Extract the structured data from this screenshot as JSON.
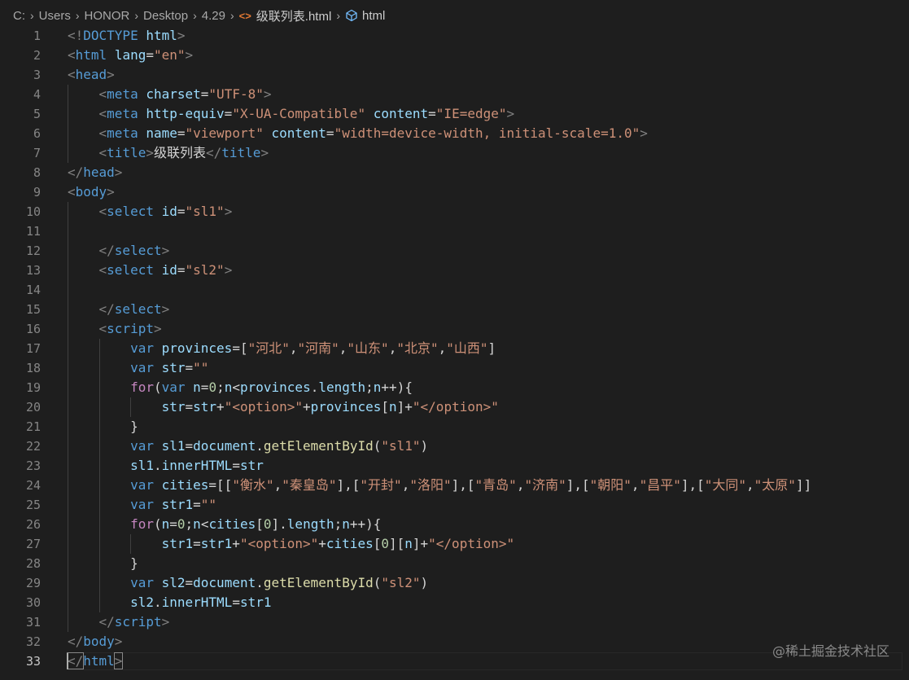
{
  "breadcrumb": [
    "C:",
    "Users",
    "HONOR",
    "Desktop",
    "4.29",
    "级联列表.html",
    "html"
  ],
  "code_lines": [
    [
      [
        "t-br",
        "<!"
      ],
      [
        "t-tag",
        "DOCTYPE"
      ],
      [
        "t-tx",
        " "
      ],
      [
        "t-at",
        "html"
      ],
      [
        "t-br",
        ">"
      ]
    ],
    [
      [
        "t-br",
        "<"
      ],
      [
        "t-tag",
        "html"
      ],
      [
        "t-tx",
        " "
      ],
      [
        "t-at",
        "lang"
      ],
      [
        "t-tx",
        "="
      ],
      [
        "t-str",
        "\"en\""
      ],
      [
        "t-br",
        ">"
      ]
    ],
    [
      [
        "t-br",
        "<"
      ],
      [
        "t-tag",
        "head"
      ],
      [
        "t-br",
        ">"
      ]
    ],
    [
      [
        "t-tx",
        "    "
      ],
      [
        "t-br",
        "<"
      ],
      [
        "t-tag",
        "meta"
      ],
      [
        "t-tx",
        " "
      ],
      [
        "t-at",
        "charset"
      ],
      [
        "t-tx",
        "="
      ],
      [
        "t-str",
        "\"UTF-8\""
      ],
      [
        "t-br",
        ">"
      ]
    ],
    [
      [
        "t-tx",
        "    "
      ],
      [
        "t-br",
        "<"
      ],
      [
        "t-tag",
        "meta"
      ],
      [
        "t-tx",
        " "
      ],
      [
        "t-at",
        "http-equiv"
      ],
      [
        "t-tx",
        "="
      ],
      [
        "t-str",
        "\"X-UA-Compatible\""
      ],
      [
        "t-tx",
        " "
      ],
      [
        "t-at",
        "content"
      ],
      [
        "t-tx",
        "="
      ],
      [
        "t-str",
        "\"IE=edge\""
      ],
      [
        "t-br",
        ">"
      ]
    ],
    [
      [
        "t-tx",
        "    "
      ],
      [
        "t-br",
        "<"
      ],
      [
        "t-tag",
        "meta"
      ],
      [
        "t-tx",
        " "
      ],
      [
        "t-at",
        "name"
      ],
      [
        "t-tx",
        "="
      ],
      [
        "t-str",
        "\"viewport\""
      ],
      [
        "t-tx",
        " "
      ],
      [
        "t-at",
        "content"
      ],
      [
        "t-tx",
        "="
      ],
      [
        "t-str",
        "\"width=device-width, initial-scale=1.0\""
      ],
      [
        "t-br",
        ">"
      ]
    ],
    [
      [
        "t-tx",
        "    "
      ],
      [
        "t-br",
        "<"
      ],
      [
        "t-tag",
        "title"
      ],
      [
        "t-br",
        ">"
      ],
      [
        "t-tx",
        "级联列表"
      ],
      [
        "t-br",
        "</"
      ],
      [
        "t-tag",
        "title"
      ],
      [
        "t-br",
        ">"
      ]
    ],
    [
      [
        "t-br",
        "</"
      ],
      [
        "t-tag",
        "head"
      ],
      [
        "t-br",
        ">"
      ]
    ],
    [
      [
        "t-br",
        "<"
      ],
      [
        "t-tag",
        "body"
      ],
      [
        "t-br",
        ">"
      ]
    ],
    [
      [
        "t-tx",
        "    "
      ],
      [
        "t-br",
        "<"
      ],
      [
        "t-tag",
        "select"
      ],
      [
        "t-tx",
        " "
      ],
      [
        "t-at",
        "id"
      ],
      [
        "t-tx",
        "="
      ],
      [
        "t-str",
        "\"sl1\""
      ],
      [
        "t-br",
        ">"
      ]
    ],
    [],
    [
      [
        "t-tx",
        "    "
      ],
      [
        "t-br",
        "</"
      ],
      [
        "t-tag",
        "select"
      ],
      [
        "t-br",
        ">"
      ]
    ],
    [
      [
        "t-tx",
        "    "
      ],
      [
        "t-br",
        "<"
      ],
      [
        "t-tag",
        "select"
      ],
      [
        "t-tx",
        " "
      ],
      [
        "t-at",
        "id"
      ],
      [
        "t-tx",
        "="
      ],
      [
        "t-str",
        "\"sl2\""
      ],
      [
        "t-br",
        ">"
      ]
    ],
    [],
    [
      [
        "t-tx",
        "    "
      ],
      [
        "t-br",
        "</"
      ],
      [
        "t-tag",
        "select"
      ],
      [
        "t-br",
        ">"
      ]
    ],
    [
      [
        "t-tx",
        "    "
      ],
      [
        "t-br",
        "<"
      ],
      [
        "t-tag",
        "script"
      ],
      [
        "t-br",
        ">"
      ]
    ],
    [
      [
        "t-tx",
        "        "
      ],
      [
        "t-kw",
        "var"
      ],
      [
        "t-tx",
        " "
      ],
      [
        "t-var",
        "provinces"
      ],
      [
        "t-tx",
        "=["
      ],
      [
        "t-str",
        "\"河北\""
      ],
      [
        "t-tx",
        ","
      ],
      [
        "t-str",
        "\"河南\""
      ],
      [
        "t-tx",
        ","
      ],
      [
        "t-str",
        "\"山东\""
      ],
      [
        "t-tx",
        ","
      ],
      [
        "t-str",
        "\"北京\""
      ],
      [
        "t-tx",
        ","
      ],
      [
        "t-str",
        "\"山西\""
      ],
      [
        "t-tx",
        "]"
      ]
    ],
    [
      [
        "t-tx",
        "        "
      ],
      [
        "t-kw",
        "var"
      ],
      [
        "t-tx",
        " "
      ],
      [
        "t-var",
        "str"
      ],
      [
        "t-tx",
        "="
      ],
      [
        "t-str",
        "\"\""
      ]
    ],
    [
      [
        "t-tx",
        "        "
      ],
      [
        "t-ctl",
        "for"
      ],
      [
        "t-tx",
        "("
      ],
      [
        "t-kw",
        "var"
      ],
      [
        "t-tx",
        " "
      ],
      [
        "t-var",
        "n"
      ],
      [
        "t-tx",
        "="
      ],
      [
        "t-num",
        "0"
      ],
      [
        "t-tx",
        ";"
      ],
      [
        "t-var",
        "n"
      ],
      [
        "t-tx",
        "<"
      ],
      [
        "t-var",
        "provinces"
      ],
      [
        "t-tx",
        "."
      ],
      [
        "t-var",
        "length"
      ],
      [
        "t-tx",
        ";"
      ],
      [
        "t-var",
        "n"
      ],
      [
        "t-tx",
        "++){"
      ]
    ],
    [
      [
        "t-tx",
        "            "
      ],
      [
        "t-var",
        "str"
      ],
      [
        "t-tx",
        "="
      ],
      [
        "t-var",
        "str"
      ],
      [
        "t-tx",
        "+"
      ],
      [
        "t-str",
        "\"<option>\""
      ],
      [
        "t-tx",
        "+"
      ],
      [
        "t-var",
        "provinces"
      ],
      [
        "t-tx",
        "["
      ],
      [
        "t-var",
        "n"
      ],
      [
        "t-tx",
        "]+"
      ],
      [
        "t-str",
        "\"</option>\""
      ]
    ],
    [
      [
        "t-tx",
        "        }"
      ]
    ],
    [
      [
        "t-tx",
        "        "
      ],
      [
        "t-kw",
        "var"
      ],
      [
        "t-tx",
        " "
      ],
      [
        "t-var",
        "sl1"
      ],
      [
        "t-tx",
        "="
      ],
      [
        "t-var",
        "document"
      ],
      [
        "t-tx",
        "."
      ],
      [
        "t-fn",
        "getElementById"
      ],
      [
        "t-tx",
        "("
      ],
      [
        "t-str",
        "\"sl1\""
      ],
      [
        "t-tx",
        ")"
      ]
    ],
    [
      [
        "t-tx",
        "        "
      ],
      [
        "t-var",
        "sl1"
      ],
      [
        "t-tx",
        "."
      ],
      [
        "t-var",
        "innerHTML"
      ],
      [
        "t-tx",
        "="
      ],
      [
        "t-var",
        "str"
      ]
    ],
    [
      [
        "t-tx",
        "        "
      ],
      [
        "t-kw",
        "var"
      ],
      [
        "t-tx",
        " "
      ],
      [
        "t-var",
        "cities"
      ],
      [
        "t-tx",
        "=[["
      ],
      [
        "t-str",
        "\"衡水\""
      ],
      [
        "t-tx",
        ","
      ],
      [
        "t-str",
        "\"秦皇岛\""
      ],
      [
        "t-tx",
        "],["
      ],
      [
        "t-str",
        "\"开封\""
      ],
      [
        "t-tx",
        ","
      ],
      [
        "t-str",
        "\"洛阳\""
      ],
      [
        "t-tx",
        "],["
      ],
      [
        "t-str",
        "\"青岛\""
      ],
      [
        "t-tx",
        ","
      ],
      [
        "t-str",
        "\"济南\""
      ],
      [
        "t-tx",
        "],["
      ],
      [
        "t-str",
        "\"朝阳\""
      ],
      [
        "t-tx",
        ","
      ],
      [
        "t-str",
        "\"昌平\""
      ],
      [
        "t-tx",
        "],["
      ],
      [
        "t-str",
        "\"大同\""
      ],
      [
        "t-tx",
        ","
      ],
      [
        "t-str",
        "\"太原\""
      ],
      [
        "t-tx",
        "]]"
      ]
    ],
    [
      [
        "t-tx",
        "        "
      ],
      [
        "t-kw",
        "var"
      ],
      [
        "t-tx",
        " "
      ],
      [
        "t-var",
        "str1"
      ],
      [
        "t-tx",
        "="
      ],
      [
        "t-str",
        "\"\""
      ]
    ],
    [
      [
        "t-tx",
        "        "
      ],
      [
        "t-ctl",
        "for"
      ],
      [
        "t-tx",
        "("
      ],
      [
        "t-var",
        "n"
      ],
      [
        "t-tx",
        "="
      ],
      [
        "t-num",
        "0"
      ],
      [
        "t-tx",
        ";"
      ],
      [
        "t-var",
        "n"
      ],
      [
        "t-tx",
        "<"
      ],
      [
        "t-var",
        "cities"
      ],
      [
        "t-tx",
        "["
      ],
      [
        "t-num",
        "0"
      ],
      [
        "t-tx",
        "]."
      ],
      [
        "t-var",
        "length"
      ],
      [
        "t-tx",
        ";"
      ],
      [
        "t-var",
        "n"
      ],
      [
        "t-tx",
        "++){"
      ]
    ],
    [
      [
        "t-tx",
        "            "
      ],
      [
        "t-var",
        "str1"
      ],
      [
        "t-tx",
        "="
      ],
      [
        "t-var",
        "str1"
      ],
      [
        "t-tx",
        "+"
      ],
      [
        "t-str",
        "\"<option>\""
      ],
      [
        "t-tx",
        "+"
      ],
      [
        "t-var",
        "cities"
      ],
      [
        "t-tx",
        "["
      ],
      [
        "t-num",
        "0"
      ],
      [
        "t-tx",
        "]["
      ],
      [
        "t-var",
        "n"
      ],
      [
        "t-tx",
        "]+"
      ],
      [
        "t-str",
        "\"</option>\""
      ]
    ],
    [
      [
        "t-tx",
        "        }"
      ]
    ],
    [
      [
        "t-tx",
        "        "
      ],
      [
        "t-kw",
        "var"
      ],
      [
        "t-tx",
        " "
      ],
      [
        "t-var",
        "sl2"
      ],
      [
        "t-tx",
        "="
      ],
      [
        "t-var",
        "document"
      ],
      [
        "t-tx",
        "."
      ],
      [
        "t-fn",
        "getElementById"
      ],
      [
        "t-tx",
        "("
      ],
      [
        "t-str",
        "\"sl2\""
      ],
      [
        "t-tx",
        ")"
      ]
    ],
    [
      [
        "t-tx",
        "        "
      ],
      [
        "t-var",
        "sl2"
      ],
      [
        "t-tx",
        "."
      ],
      [
        "t-var",
        "innerHTML"
      ],
      [
        "t-tx",
        "="
      ],
      [
        "t-var",
        "str1"
      ]
    ],
    [
      [
        "t-tx",
        "    "
      ],
      [
        "t-br",
        "</"
      ],
      [
        "t-tag",
        "script"
      ],
      [
        "t-br",
        ">"
      ]
    ],
    [
      [
        "t-br",
        "</"
      ],
      [
        "t-tag",
        "body"
      ],
      [
        "t-br",
        ">"
      ]
    ],
    [
      [
        "t-br",
        "</"
      ],
      [
        "t-tag",
        "html"
      ],
      [
        "t-br",
        ">"
      ]
    ]
  ],
  "active_line": 33,
  "watermark": "@稀土掘金技术社区"
}
